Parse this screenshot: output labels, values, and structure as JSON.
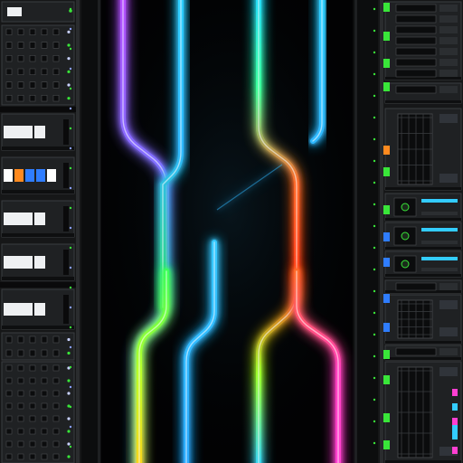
{
  "scene": {
    "background": "#020203",
    "rack_body": "#161718",
    "rack_frame": "#0c0d0e",
    "rail": "#2a2c2e",
    "panel": "#1f2123",
    "panel_edge": "#3a3d40",
    "led_green": "#39e639",
    "led_blue": "#2f7dff",
    "led_white": "#eef0f2",
    "led_orange": "#ff8a1f",
    "led_cyan": "#33ccff",
    "led_magenta": "#ff3fd2"
  },
  "cables": [
    {
      "name": "magenta-left",
      "colors": [
        "#b84dff",
        "#6b7dff",
        "#2fc1ff"
      ]
    },
    {
      "name": "cyan-left",
      "colors": [
        "#2fd0ff",
        "#2fb8ff",
        "#2fe06a"
      ]
    },
    {
      "name": "green-yellow",
      "colors": [
        "#3bff5a",
        "#b9ff2a",
        "#ffd21a"
      ]
    },
    {
      "name": "short-cyan",
      "colors": [
        "#36c9ff",
        "#2aa8ff"
      ]
    },
    {
      "name": "teal-right",
      "colors": [
        "#23d9ff",
        "#3aff9b",
        "#ff6a2a",
        "#ff3a1a",
        "#9bff2a",
        "#2fd0ff"
      ]
    },
    {
      "name": "teal-hook",
      "colors": [
        "#2fd0ff",
        "#2fb8ff"
      ]
    },
    {
      "name": "magenta-right",
      "colors": [
        "#ff6a2a",
        "#ff3fbf",
        "#ff3fd2"
      ]
    }
  ]
}
